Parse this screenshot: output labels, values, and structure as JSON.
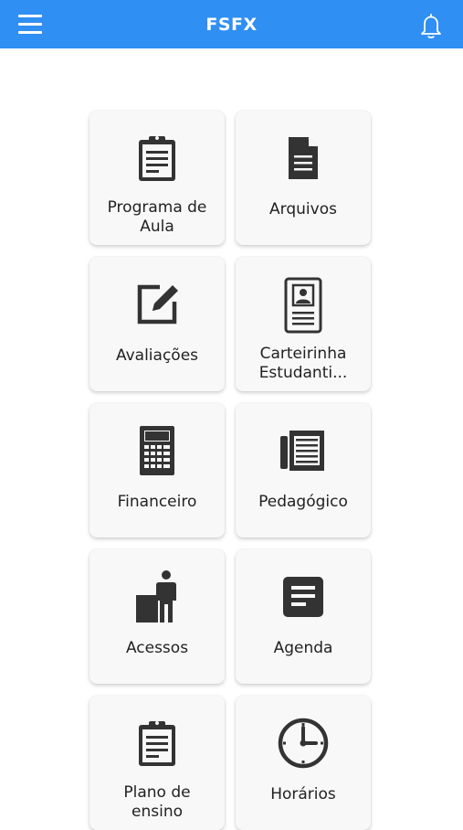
{
  "header": {
    "title": "FSFX",
    "menu_icon": "hamburger-menu-icon",
    "notification_icon": "bell-icon",
    "background_color": "#2f8ff3"
  },
  "menu": {
    "items": [
      {
        "label": "Programa de\nAula",
        "icon": "clipboard-icon"
      },
      {
        "label": "Arquivos",
        "icon": "document-icon"
      },
      {
        "label": "Avaliações",
        "icon": "edit-icon"
      },
      {
        "label": "Carteirinha\nEstudanti...",
        "icon": "id-card-icon"
      },
      {
        "label": "Financeiro",
        "icon": "calculator-icon"
      },
      {
        "label": "Pedagógico",
        "icon": "newspaper-icon"
      },
      {
        "label": "Acessos",
        "icon": "person-desk-icon"
      },
      {
        "label": "Agenda",
        "icon": "agenda-icon"
      },
      {
        "label": "Plano de\nensino",
        "icon": "clipboard-icon"
      },
      {
        "label": "Horários",
        "icon": "clock-icon"
      }
    ]
  },
  "colors": {
    "icon": "#333333",
    "card_background": "#f8f8f8"
  }
}
